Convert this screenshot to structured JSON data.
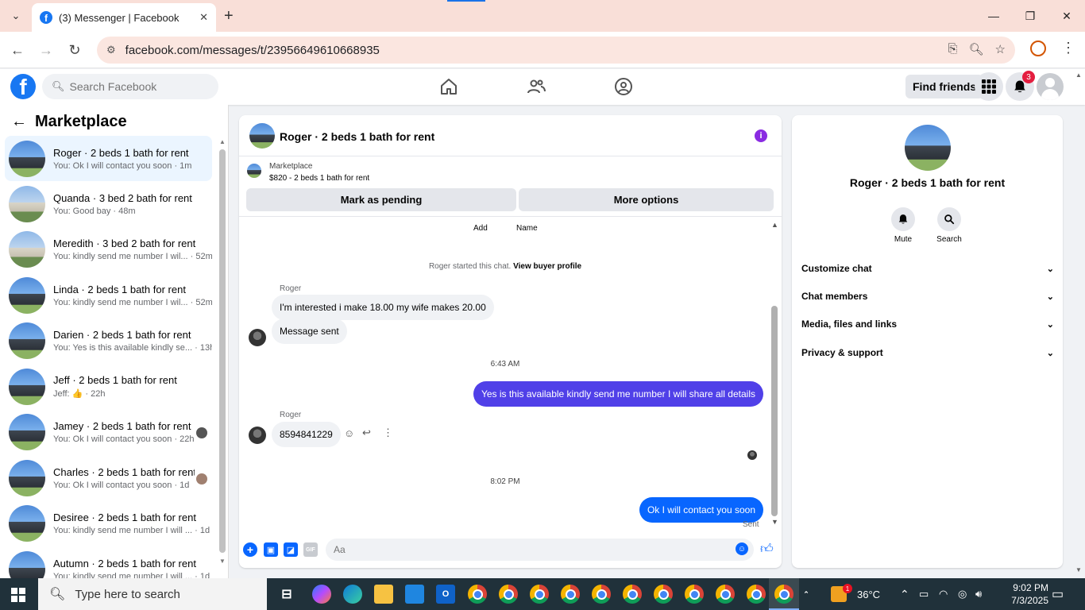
{
  "browser": {
    "tab_title": "(3) Messenger | Facebook",
    "url": "facebook.com/messages/t/23956649610668935"
  },
  "header": {
    "search_placeholder": "Search Facebook",
    "find_friends": "Find friends",
    "notification_count": "3"
  },
  "sidebar": {
    "title": "Marketplace",
    "conversations": [
      {
        "name": "Roger · 2 beds 1 bath for rent",
        "preview": "You: Ok I will contact you soon · 1m",
        "active": true
      },
      {
        "name": "Quanda · 3 bed 2 bath for rent",
        "preview": "You: Good bay · 48m"
      },
      {
        "name": "Meredith · 3 bed 2 bath for rent",
        "preview": "You: kindly send me number I wil... · 52m"
      },
      {
        "name": "Linda · 2 beds 1 bath for rent",
        "preview": "You: kindly send me number I wil... · 52m"
      },
      {
        "name": "Darien · 2 beds 1 bath for rent",
        "preview": "You: Yes is this available kindly se... · 13h"
      },
      {
        "name": "Jeff · 2 beds 1 bath for rent",
        "preview": "Jeff: 👍 · 22h"
      },
      {
        "name": "Jamey · 2 beds 1 bath for rent",
        "preview": "You: Ok I will contact you soon · 22h"
      },
      {
        "name": "Charles · 2 beds 1 bath for rent",
        "preview": "You: Ok I will contact you soon · 1d"
      },
      {
        "name": "Desiree · 2 beds 1 bath for rent",
        "preview": "You: kindly send me number I will ... · 1d"
      },
      {
        "name": "Autumn · 2 beds 1 bath for rent",
        "preview": "You: kindly send me number I will ... · 1d"
      }
    ]
  },
  "chat": {
    "title": "Roger · 2 beds 1 bath for rent",
    "marketplace_label": "Marketplace",
    "listing": "$820 - 2 beds 1 bath for rent",
    "mark_pending": "Mark as pending",
    "more_options": "More options",
    "add_label": "Add",
    "name_label": "Name",
    "started_text": "Roger started this chat.",
    "view_profile": "View buyer profile",
    "sender_1": "Roger",
    "msg_1": "I'm interested i make 18.00 my wife makes 20.00",
    "msg_2": "Message sent",
    "time_1": "6:43 AM",
    "msg_3": "Yes is this available kindly send me number I will share all details",
    "sender_2": "Roger",
    "msg_4": "8594841229",
    "time_2": "8:02 PM",
    "msg_5": "Ok I will contact you soon",
    "sent_label": "Sent",
    "composer_placeholder": "Aa"
  },
  "right_panel": {
    "name": "Roger · 2 beds 1 bath for rent",
    "mute": "Mute",
    "search": "Search",
    "sections": [
      "Customize chat",
      "Chat members",
      "Media, files and links",
      "Privacy & support"
    ]
  },
  "taskbar": {
    "search_placeholder": "Type here to search",
    "temperature": "36°C",
    "weather_badge": "1",
    "time": "9:02 PM",
    "date": "7/3/2025"
  },
  "colors": {
    "brand": "#1877f2",
    "outgoing_bubble": "#0866ff",
    "outgoing_bubble_alt": "#5040e8",
    "active_conversation": "#ebf5ff"
  }
}
